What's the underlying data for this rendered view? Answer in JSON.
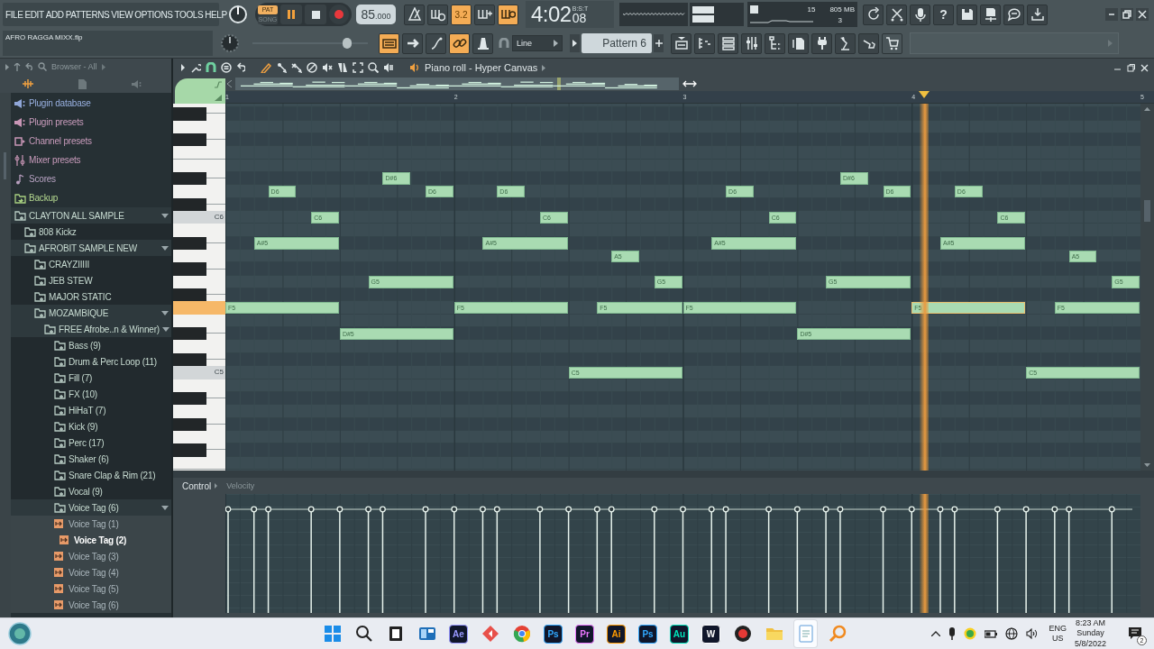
{
  "menu": [
    "FILE",
    "EDIT",
    "ADD",
    "PATTERNS",
    "VIEW",
    "OPTIONS",
    "TOOLS",
    "HELP"
  ],
  "transport": {
    "modes": [
      {
        "label": "PAT",
        "selected": true
      },
      {
        "label": "SONG",
        "selected": false
      }
    ],
    "playing": true
  },
  "tempo": {
    "whole": "85",
    "fraction": ".000"
  },
  "toggles_top": [
    {
      "on": false
    },
    {
      "on": false
    },
    {
      "label": "3.2",
      "on": true
    },
    {
      "on": false
    },
    {
      "on": true
    }
  ],
  "time": {
    "main": "4:02",
    "sub": "08",
    "unit": "B:S:T"
  },
  "monitor": {
    "value_1": "15",
    "memory": "805 MB",
    "value_2": "3"
  },
  "help": "?",
  "project": "AFRO RAGGA MIXX.flp",
  "master_volume": {
    "level": 0.82
  },
  "toggles_bottom": [
    {
      "on": true
    },
    {
      "on": false
    },
    {
      "on": false
    },
    {
      "on": true
    },
    {
      "on": false
    }
  ],
  "snap": "Line",
  "pattern": "Pattern 6",
  "browser": {
    "title": "Browser - All",
    "items": [
      {
        "label": "Plugin database",
        "kind": "plugin-database"
      },
      {
        "label": "Plugin presets",
        "kind": "plugin-presets"
      },
      {
        "label": "Channel presets",
        "kind": "channel-presets"
      },
      {
        "label": "Mixer presets",
        "kind": "mixer-presets"
      },
      {
        "label": "Scores",
        "kind": "scores"
      },
      {
        "label": "Backup",
        "kind": "backup"
      },
      {
        "label": "CLAYTON ALL SAMPLE",
        "kind": "folder",
        "expanded": true,
        "children": [
          {
            "label": "808 Kickz",
            "kind": "folder",
            "expanded": false
          },
          {
            "label": "AFROBIT SAMPLE NEW",
            "kind": "folder",
            "expanded": true,
            "children": [
              {
                "label": "CRAYZIIIII",
                "kind": "folder",
                "expanded": false
              },
              {
                "label": "JEB STEW",
                "kind": "folder",
                "expanded": false
              },
              {
                "label": "MAJOR STATIC",
                "kind": "folder",
                "expanded": false
              },
              {
                "label": "MOZAMBIQUE",
                "kind": "folder",
                "expanded": true,
                "children": [
                  {
                    "label": "FREE Afrobe..n & Winner)",
                    "kind": "folder",
                    "expanded": true,
                    "children": [
                      {
                        "label": "Bass (9)",
                        "kind": "folder",
                        "expanded": false
                      },
                      {
                        "label": "Drum & Perc Loop (11)",
                        "kind": "folder",
                        "expanded": false
                      },
                      {
                        "label": "Fill (7)",
                        "kind": "folder",
                        "expanded": false
                      },
                      {
                        "label": "FX (10)",
                        "kind": "folder",
                        "expanded": false
                      },
                      {
                        "label": "HiHaT (7)",
                        "kind": "folder",
                        "expanded": false
                      },
                      {
                        "label": "Kick (9)",
                        "kind": "folder",
                        "expanded": false
                      },
                      {
                        "label": "Perc (17)",
                        "kind": "folder",
                        "expanded": false
                      },
                      {
                        "label": "Shaker (6)",
                        "kind": "folder",
                        "expanded": false
                      },
                      {
                        "label": "Snare Clap & Rim (21)",
                        "kind": "folder",
                        "expanded": false
                      },
                      {
                        "label": "Vocal (9)",
                        "kind": "folder",
                        "expanded": false
                      },
                      {
                        "label": "Voice Tag (6)",
                        "kind": "folder",
                        "expanded": true,
                        "children": [
                          {
                            "label": "Voice Tag (1)",
                            "kind": "file",
                            "selected": false
                          },
                          {
                            "label": "Voice Tag (2)",
                            "kind": "file",
                            "selected": true
                          },
                          {
                            "label": "Voice Tag (3)",
                            "kind": "file",
                            "selected": false
                          },
                          {
                            "label": "Voice Tag (4)",
                            "kind": "file",
                            "selected": false
                          },
                          {
                            "label": "Voice Tag (5)",
                            "kind": "file",
                            "selected": false
                          },
                          {
                            "label": "Voice Tag (6)",
                            "kind": "file",
                            "selected": false
                          }
                        ]
                      }
                    ]
                  }
                ]
              }
            ]
          }
        ]
      }
    ]
  },
  "piano_roll": {
    "title": "Piano roll - Hyper Canvas",
    "ruler": [
      "1",
      "2",
      "3",
      "4",
      "5"
    ],
    "key_labels": [
      "C6",
      "C5"
    ],
    "playhead": {
      "level": 0.764
    },
    "notes": [
      {
        "label": "F5",
        "kind": "long",
        "start": {
          "level": 0
        },
        "playing": false
      },
      {
        "label": "A#5",
        "kind": "medium",
        "start": {
          "level": 0.03125
        },
        "playing": false
      },
      {
        "label": "D6",
        "kind": "short",
        "start": {
          "level": 0.046875
        },
        "playing": false
      },
      {
        "label": "C6",
        "kind": "short",
        "start": {
          "level": 0.09375
        },
        "playing": false
      },
      {
        "label": "D#5",
        "kind": "long",
        "start": {
          "level": 0.125
        },
        "playing": false
      },
      {
        "label": "G5",
        "kind": "medium",
        "start": {
          "level": 0.15625
        },
        "playing": false
      },
      {
        "label": "D#6",
        "kind": "short",
        "start": {
          "level": 0.171875
        },
        "playing": false
      },
      {
        "label": "D6",
        "kind": "short",
        "start": {
          "level": 0.21875
        },
        "playing": false
      },
      {
        "label": "F5",
        "kind": "long",
        "start": {
          "level": 0.25
        },
        "playing": false
      },
      {
        "label": "A#5",
        "kind": "medium",
        "start": {
          "level": 0.28125
        },
        "playing": false
      },
      {
        "label": "D6",
        "kind": "short",
        "start": {
          "level": 0.296875
        },
        "playing": false
      },
      {
        "label": "C6",
        "kind": "short",
        "start": {
          "level": 0.34375
        },
        "playing": false
      },
      {
        "label": "C5",
        "kind": "long",
        "start": {
          "level": 0.375
        },
        "playing": false
      },
      {
        "label": "F5",
        "kind": "medium",
        "start": {
          "level": 0.40625
        },
        "playing": false
      },
      {
        "label": "A5",
        "kind": "short",
        "start": {
          "level": 0.421875
        },
        "playing": false
      },
      {
        "label": "G5",
        "kind": "short",
        "start": {
          "level": 0.46875
        },
        "playing": false
      },
      {
        "label": "F5",
        "kind": "long",
        "start": {
          "level": 0.5
        },
        "playing": false
      },
      {
        "label": "A#5",
        "kind": "medium",
        "start": {
          "level": 0.53125
        },
        "playing": false
      },
      {
        "label": "D6",
        "kind": "short",
        "start": {
          "level": 0.546875
        },
        "playing": false
      },
      {
        "label": "C6",
        "kind": "short",
        "start": {
          "level": 0.59375
        },
        "playing": false
      },
      {
        "label": "D#5",
        "kind": "long",
        "start": {
          "level": 0.625
        },
        "playing": false
      },
      {
        "label": "G5",
        "kind": "medium",
        "start": {
          "level": 0.65625
        },
        "playing": false
      },
      {
        "label": "D#6",
        "kind": "short",
        "start": {
          "level": 0.671875
        },
        "playing": false
      },
      {
        "label": "D6",
        "kind": "short",
        "start": {
          "level": 0.71875
        },
        "playing": false
      },
      {
        "label": "F5",
        "kind": "long",
        "start": {
          "level": 0.75
        },
        "playing": true
      },
      {
        "label": "A#5",
        "kind": "medium",
        "start": {
          "level": 0.78125
        },
        "playing": false
      },
      {
        "label": "D6",
        "kind": "short",
        "start": {
          "level": 0.796875
        },
        "playing": false
      },
      {
        "label": "C6",
        "kind": "short",
        "start": {
          "level": 0.84375
        },
        "playing": false
      },
      {
        "label": "C5",
        "kind": "long",
        "start": {
          "level": 0.875
        },
        "playing": false
      },
      {
        "label": "F5",
        "kind": "medium",
        "start": {
          "level": 0.90625
        },
        "playing": false
      },
      {
        "label": "A5",
        "kind": "short",
        "start": {
          "level": 0.921875
        },
        "playing": false
      },
      {
        "label": "G5",
        "kind": "short",
        "start": {
          "level": 0.96875
        },
        "playing": false
      }
    ],
    "control": {
      "label": "Control",
      "target": "Velocity"
    }
  },
  "taskbar": {
    "apps": [
      {
        "kind": "start"
      },
      {
        "kind": "search"
      },
      {
        "kind": "taskview"
      },
      {
        "kind": "widgets"
      },
      {
        "kind": "app",
        "label": "Ae",
        "color": "#9999ff"
      },
      {
        "kind": "diamond"
      },
      {
        "kind": "browser"
      },
      {
        "kind": "app",
        "label": "Ps",
        "color": "#31a8ff"
      },
      {
        "kind": "app",
        "label": "Pr",
        "color": "#ea77ff"
      },
      {
        "kind": "app",
        "label": "Ai",
        "color": "#ff9a00"
      },
      {
        "kind": "app",
        "label": "Ps",
        "color": "#31a8ff"
      },
      {
        "kind": "app",
        "label": "Au",
        "color": "#00e4bb"
      },
      {
        "kind": "app",
        "label": "W",
        "color": "#ffffff"
      },
      {
        "kind": "record"
      },
      {
        "kind": "folder"
      },
      {
        "kind": "notes"
      },
      {
        "kind": "magnifier"
      }
    ],
    "language": [
      "ENG",
      "US"
    ],
    "clock": [
      "8:23 AM",
      "Sunday",
      "5/8/2022"
    ],
    "notifications": "2"
  }
}
